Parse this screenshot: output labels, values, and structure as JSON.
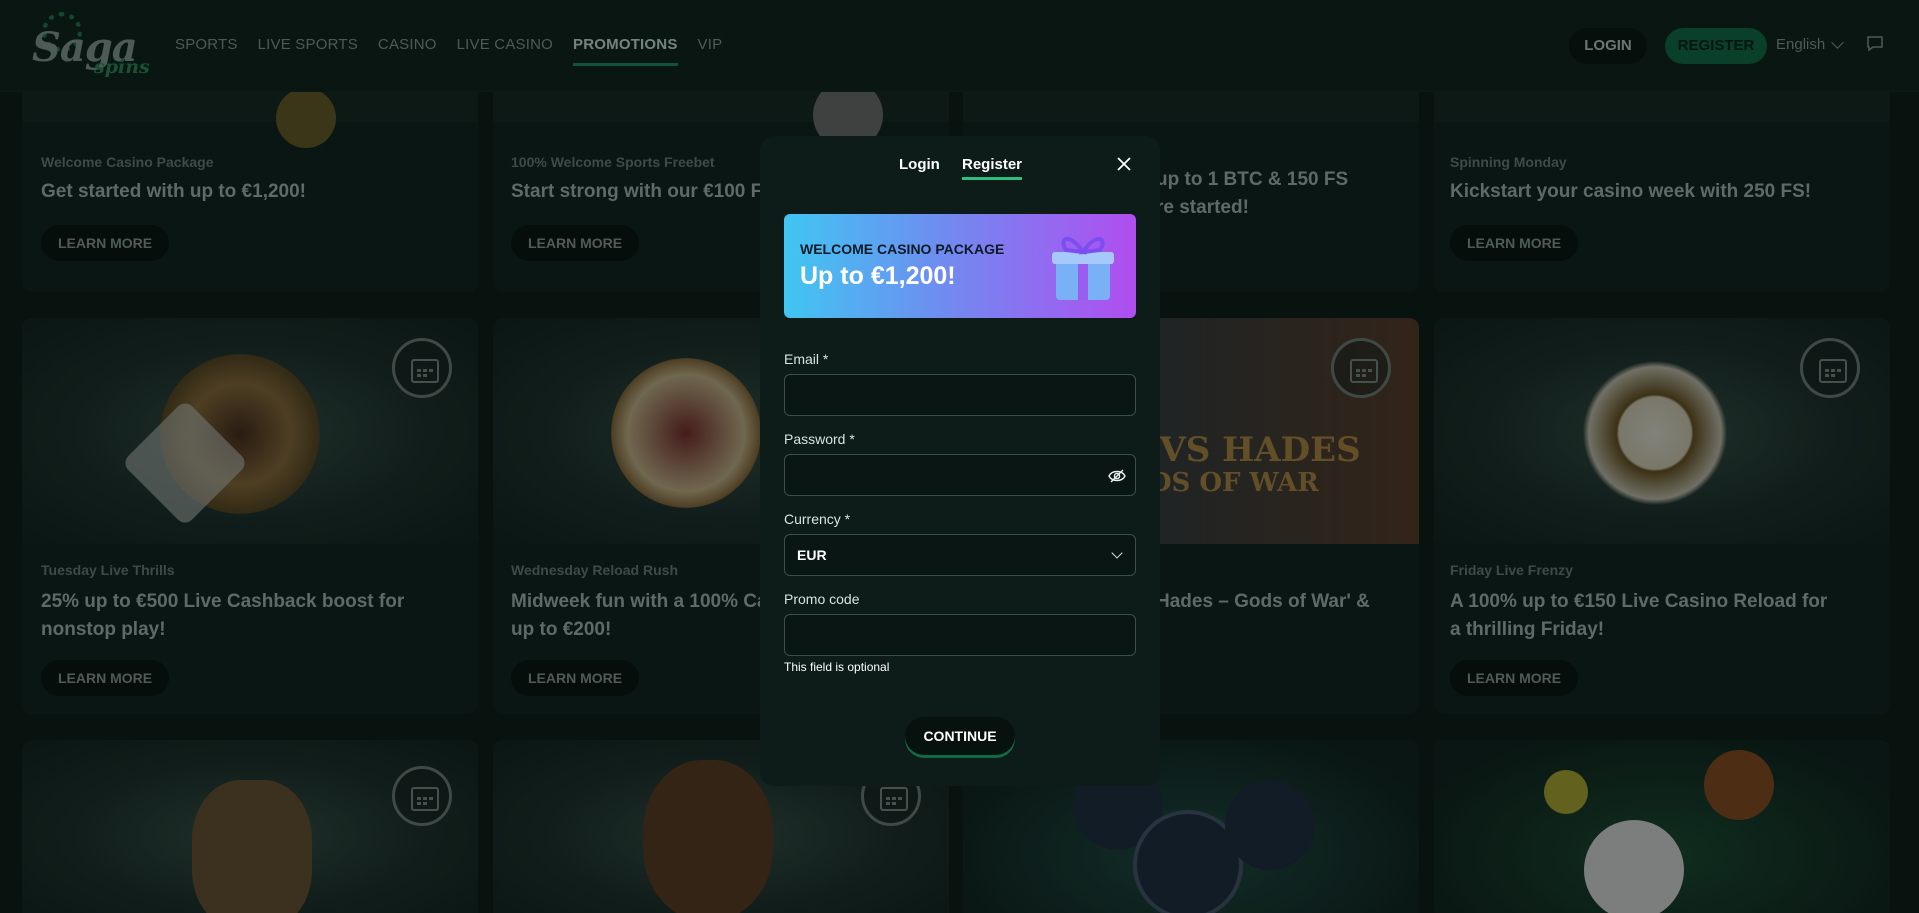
{
  "header": {
    "logo_word1": "Saga",
    "logo_word2": "spins",
    "nav": [
      "SPORTS",
      "LIVE SPORTS",
      "CASINO",
      "LIVE CASINO",
      "PROMOTIONS",
      "VIP"
    ],
    "active_nav": "PROMOTIONS",
    "login_label": "LOGIN",
    "register_label": "REGISTER",
    "language": "English"
  },
  "cards": {
    "c1": {
      "kicker": "Welcome Casino Package",
      "title": "Get started with up to €1,200!",
      "button": "LEARN MORE"
    },
    "c2": {
      "kicker": "100% Welcome Sports Freebet",
      "title": "Start strong with our €100 F",
      "button": "LEARN MORE"
    },
    "c3": {
      "title_line1": "up to 1 BTC & 150 FS",
      "title_line2": "re started!"
    },
    "c4": {
      "kicker": "Spinning Monday",
      "title": "Kickstart your casino week with 250 FS!",
      "button": "LEARN MORE"
    },
    "c5": {
      "kicker": "Tuesday Live Thrills",
      "title_line1": "25% up to €500 Live Cashback boost for",
      "title_line2": "nonstop play!",
      "button": "LEARN MORE"
    },
    "c6": {
      "kicker": "Wednesday Reload Rush",
      "title_line1": "Midweek fun with a 100% Ca",
      "title_line2": "up to €200!",
      "button": "LEARN MORE"
    },
    "c7": {
      "title": "Hades – Gods of War' &",
      "game_line1": "S VS HADES",
      "game_line2": "DS OF WAR"
    },
    "c8": {
      "kicker": "Friday Live Frenzy",
      "title_line1": "A 100% up to €150 Live Casino Reload for",
      "title_line2": "a thrilling Friday!",
      "button": "LEARN MORE"
    }
  },
  "modal": {
    "tab_login": "Login",
    "tab_register": "Register",
    "active_tab": "Register",
    "banner_kicker": "WELCOME CASINO PACKAGE",
    "banner_title": "Up to €1,200!",
    "email_label": "Email *",
    "email_value": "",
    "password_label": "Password *",
    "password_value": "",
    "currency_label": "Currency *",
    "currency_value": "EUR",
    "promo_label": "Promo code",
    "promo_value": "",
    "promo_hint": "This field is optional",
    "continue_label": "CONTINUE"
  },
  "colors": {
    "brand_green": "#0f6a45",
    "accent": "#2fbf7c",
    "banner_start": "#40c6f2",
    "banner_end": "#b14df0"
  }
}
